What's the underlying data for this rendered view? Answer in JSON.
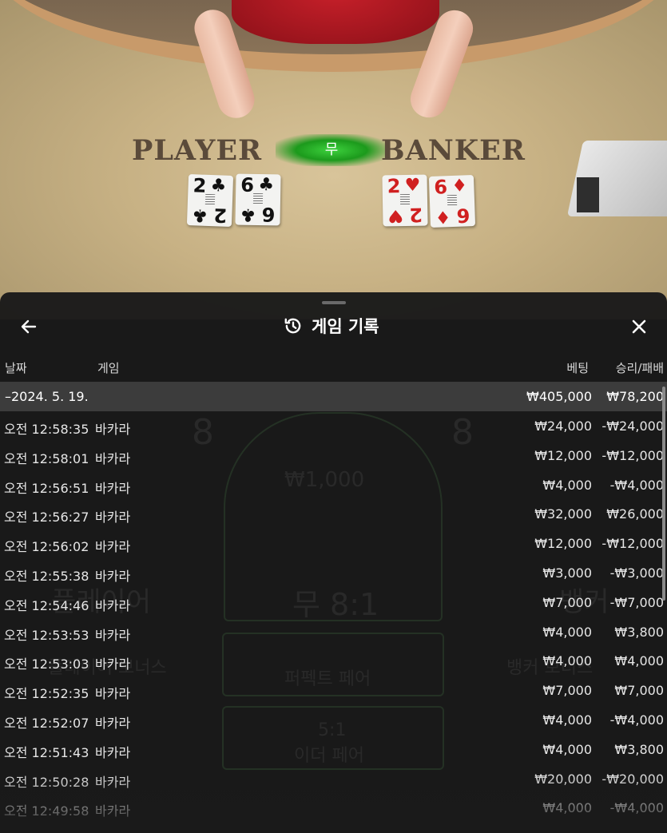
{
  "table": {
    "player_label": "PLAYER",
    "banker_label": "BANKER",
    "tie_label": "무",
    "player_cards": [
      {
        "rank": "2",
        "suit": "♣",
        "color": "#111111"
      },
      {
        "rank": "6",
        "suit": "♣",
        "color": "#111111"
      }
    ],
    "banker_cards": [
      {
        "rank": "2",
        "suit": "♥",
        "color": "#d02020"
      },
      {
        "rank": "6",
        "suit": "♦",
        "color": "#d02020"
      }
    ]
  },
  "panel": {
    "title": "게임 기록",
    "back_icon": "arrow-left-icon",
    "close_icon": "close-icon",
    "history_icon": "history-icon",
    "columns": {
      "date": "날짜",
      "game": "게임",
      "bet": "베팅",
      "result": "승리/패배"
    },
    "date_group": {
      "date": "–2024. 5. 19.",
      "bet_total": "₩405,000",
      "result_total": "₩78,200"
    },
    "rows": [
      {
        "time": "오전 12:58:35",
        "game": "바카라",
        "bet": "₩24,000",
        "result": "-₩24,000"
      },
      {
        "time": "오전 12:58:01",
        "game": "바카라",
        "bet": "₩12,000",
        "result": "-₩12,000"
      },
      {
        "time": "오전 12:56:51",
        "game": "바카라",
        "bet": "₩4,000",
        "result": "-₩4,000"
      },
      {
        "time": "오전 12:56:27",
        "game": "바카라",
        "bet": "₩32,000",
        "result": "₩26,000"
      },
      {
        "time": "오전 12:56:02",
        "game": "바카라",
        "bet": "₩12,000",
        "result": "-₩12,000"
      },
      {
        "time": "오전 12:55:38",
        "game": "바카라",
        "bet": "₩3,000",
        "result": "-₩3,000"
      },
      {
        "time": "오전 12:54:46",
        "game": "바카라",
        "bet": "₩7,000",
        "result": "-₩7,000"
      },
      {
        "time": "오전 12:53:53",
        "game": "바카라",
        "bet": "₩4,000",
        "result": "₩3,800"
      },
      {
        "time": "오전 12:53:03",
        "game": "바카라",
        "bet": "₩4,000",
        "result": "₩4,000"
      },
      {
        "time": "오전 12:52:35",
        "game": "바카라",
        "bet": "₩7,000",
        "result": "₩7,000"
      },
      {
        "time": "오전 12:52:07",
        "game": "바카라",
        "bet": "₩4,000",
        "result": "-₩4,000"
      },
      {
        "time": "오전 12:51:43",
        "game": "바카라",
        "bet": "₩4,000",
        "result": "₩3,800"
      },
      {
        "time": "오전 12:50:28",
        "game": "바카라",
        "bet": "₩20,000",
        "result": "-₩20,000"
      },
      {
        "time": "오전 12:49:58",
        "game": "바카라",
        "bet": "₩4,000",
        "result": "-₩4,000"
      }
    ]
  },
  "background_ghost": {
    "player_score": "8",
    "banker_score": "8",
    "tie_bet": "₩1,000",
    "tie_odds": "무 8:1",
    "player_label": "플레이어",
    "banker_label": "뱅커",
    "perfect_pair": "퍼펙트 페어",
    "either_pair_odds": "5:1",
    "either_pair": "이더 페어",
    "player_bonus": "플레이어 보너스",
    "banker_bonus": "뱅커 보너스"
  }
}
